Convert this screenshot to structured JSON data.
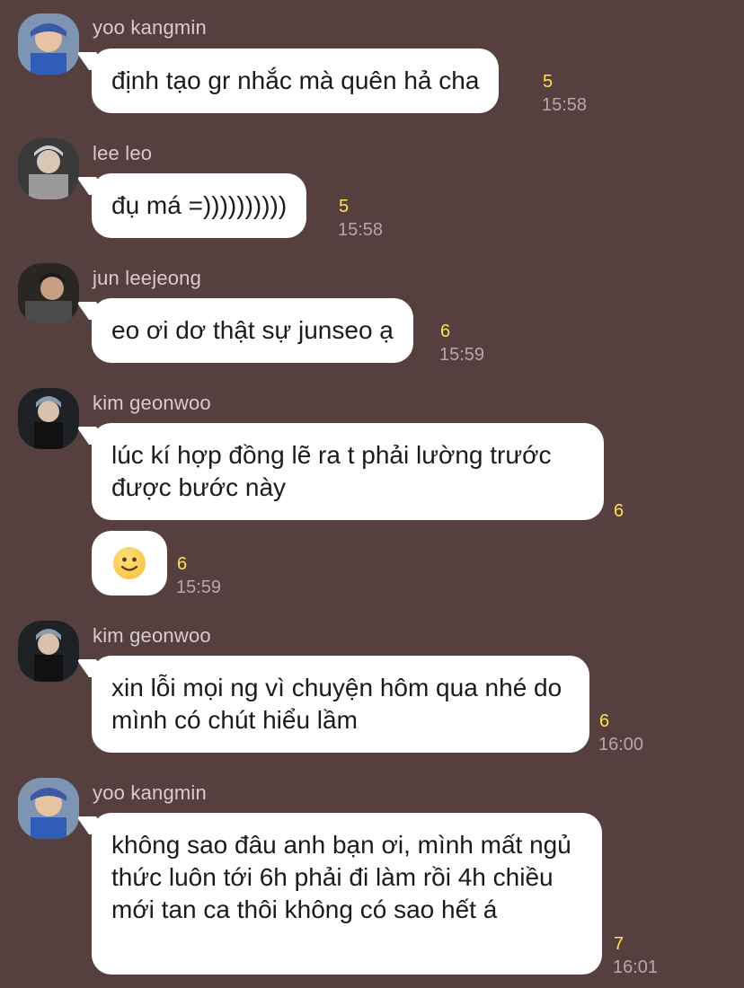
{
  "colors": {
    "background": "#553f3f",
    "bubble": "#ffffff",
    "unread": "#ffe14d",
    "time": "#b6a8a8",
    "sender": "#d9cccc"
  },
  "messages": [
    {
      "sender": "yoo kangmin",
      "text": "định tạo gr nhắc mà quên hả cha",
      "unread": "5",
      "time": "15:58"
    },
    {
      "sender": "lee leo",
      "text": "đụ má =))))))))))",
      "unread": "5",
      "time": "15:58"
    },
    {
      "sender": "jun leejeong",
      "text": "eo ơi dơ thật sự junseo ạ",
      "unread": "6",
      "time": "15:59"
    },
    {
      "sender": "kim geonwoo",
      "text": "lúc kí hợp đồng lẽ ra t phải lường trước được bước này",
      "unread": "6",
      "time": ""
    },
    {
      "sender": "",
      "emoji": "slightly-smiling-face-icon",
      "unread": "6",
      "time": "15:59"
    },
    {
      "sender": "kim geonwoo",
      "text": "xin lỗi mọi ng vì chuyện hôm qua nhé do mình có chút hiểu lầm",
      "unread": "6",
      "time": "16:00"
    },
    {
      "sender": "yoo kangmin",
      "text": "không sao đâu anh bạn ơi, mình mất ngủ thức luôn tới 6h phải đi làm rồi 4h chiều mới tan ca thôi không có sao hết á",
      "unread": "7",
      "time": "16:01"
    }
  ]
}
